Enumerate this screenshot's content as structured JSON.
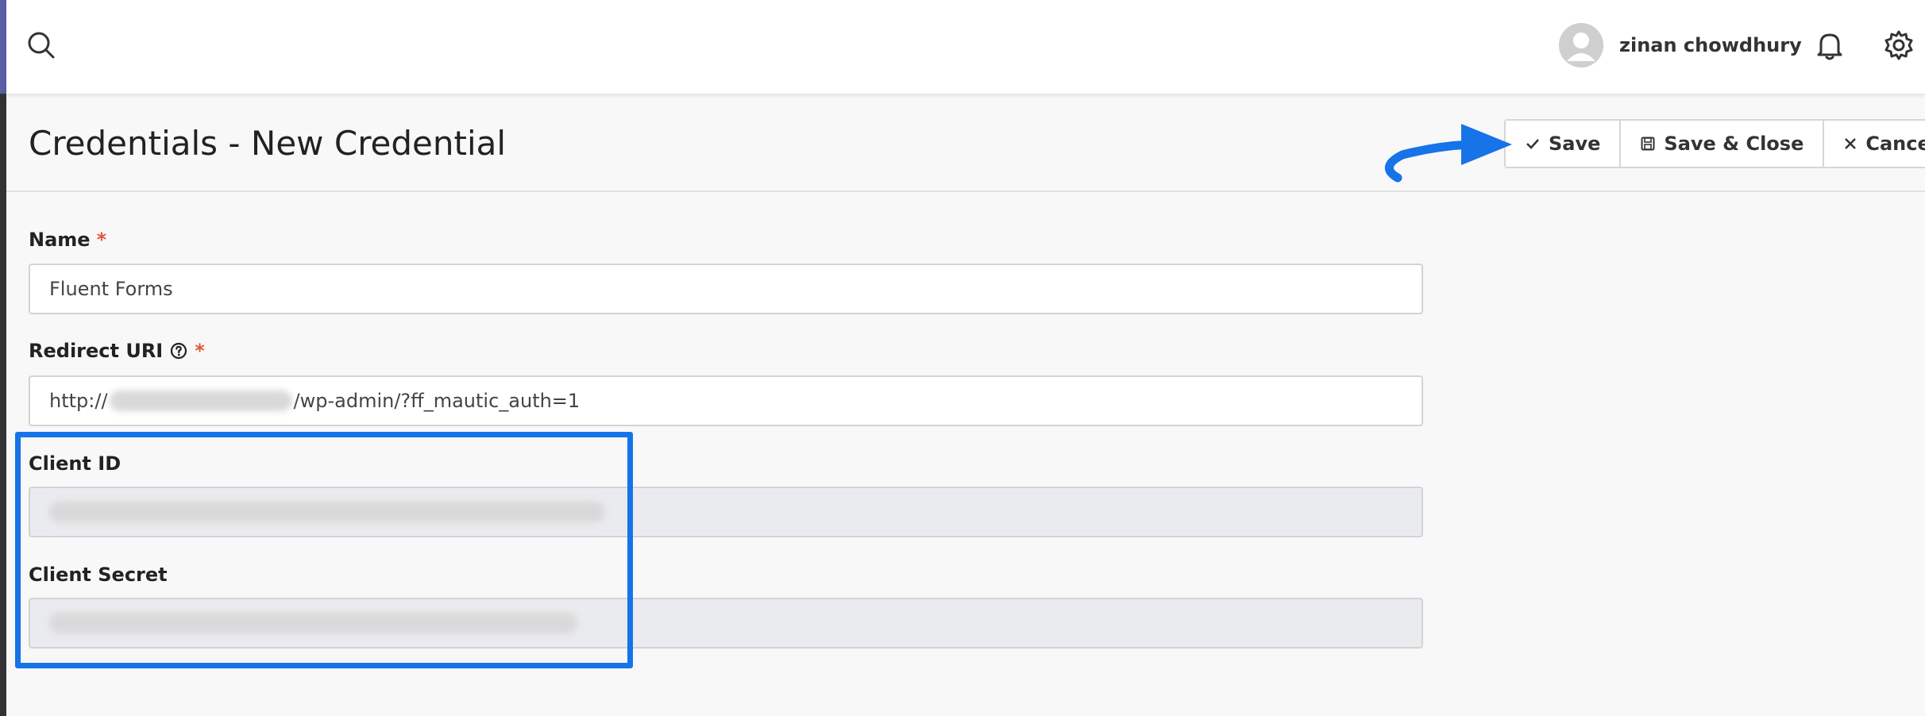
{
  "topbar": {
    "search_icon": "search-icon",
    "user": {
      "name": "zinan chowdhury"
    },
    "notification_icon": "bell-icon",
    "settings_icon": "gear-icon"
  },
  "page": {
    "title": "Credentials - New Credential"
  },
  "toolbar": {
    "save_label": "Save",
    "save_close_label": "Save & Close",
    "cancel_label": "Cancel"
  },
  "form": {
    "name": {
      "label": "Name",
      "required_mark": "*",
      "value": "Fluent Forms"
    },
    "redirect_uri": {
      "label": "Redirect URI",
      "required_mark": "*",
      "value_prefix": "http://",
      "value_suffix": "/wp-admin/?ff_mautic_auth=1"
    },
    "client_id": {
      "label": "Client ID"
    },
    "client_secret": {
      "label": "Client Secret"
    }
  },
  "colors": {
    "highlight": "#1673e8",
    "required": "#e2563c",
    "sidebar_accent": "#5a5fa6"
  }
}
